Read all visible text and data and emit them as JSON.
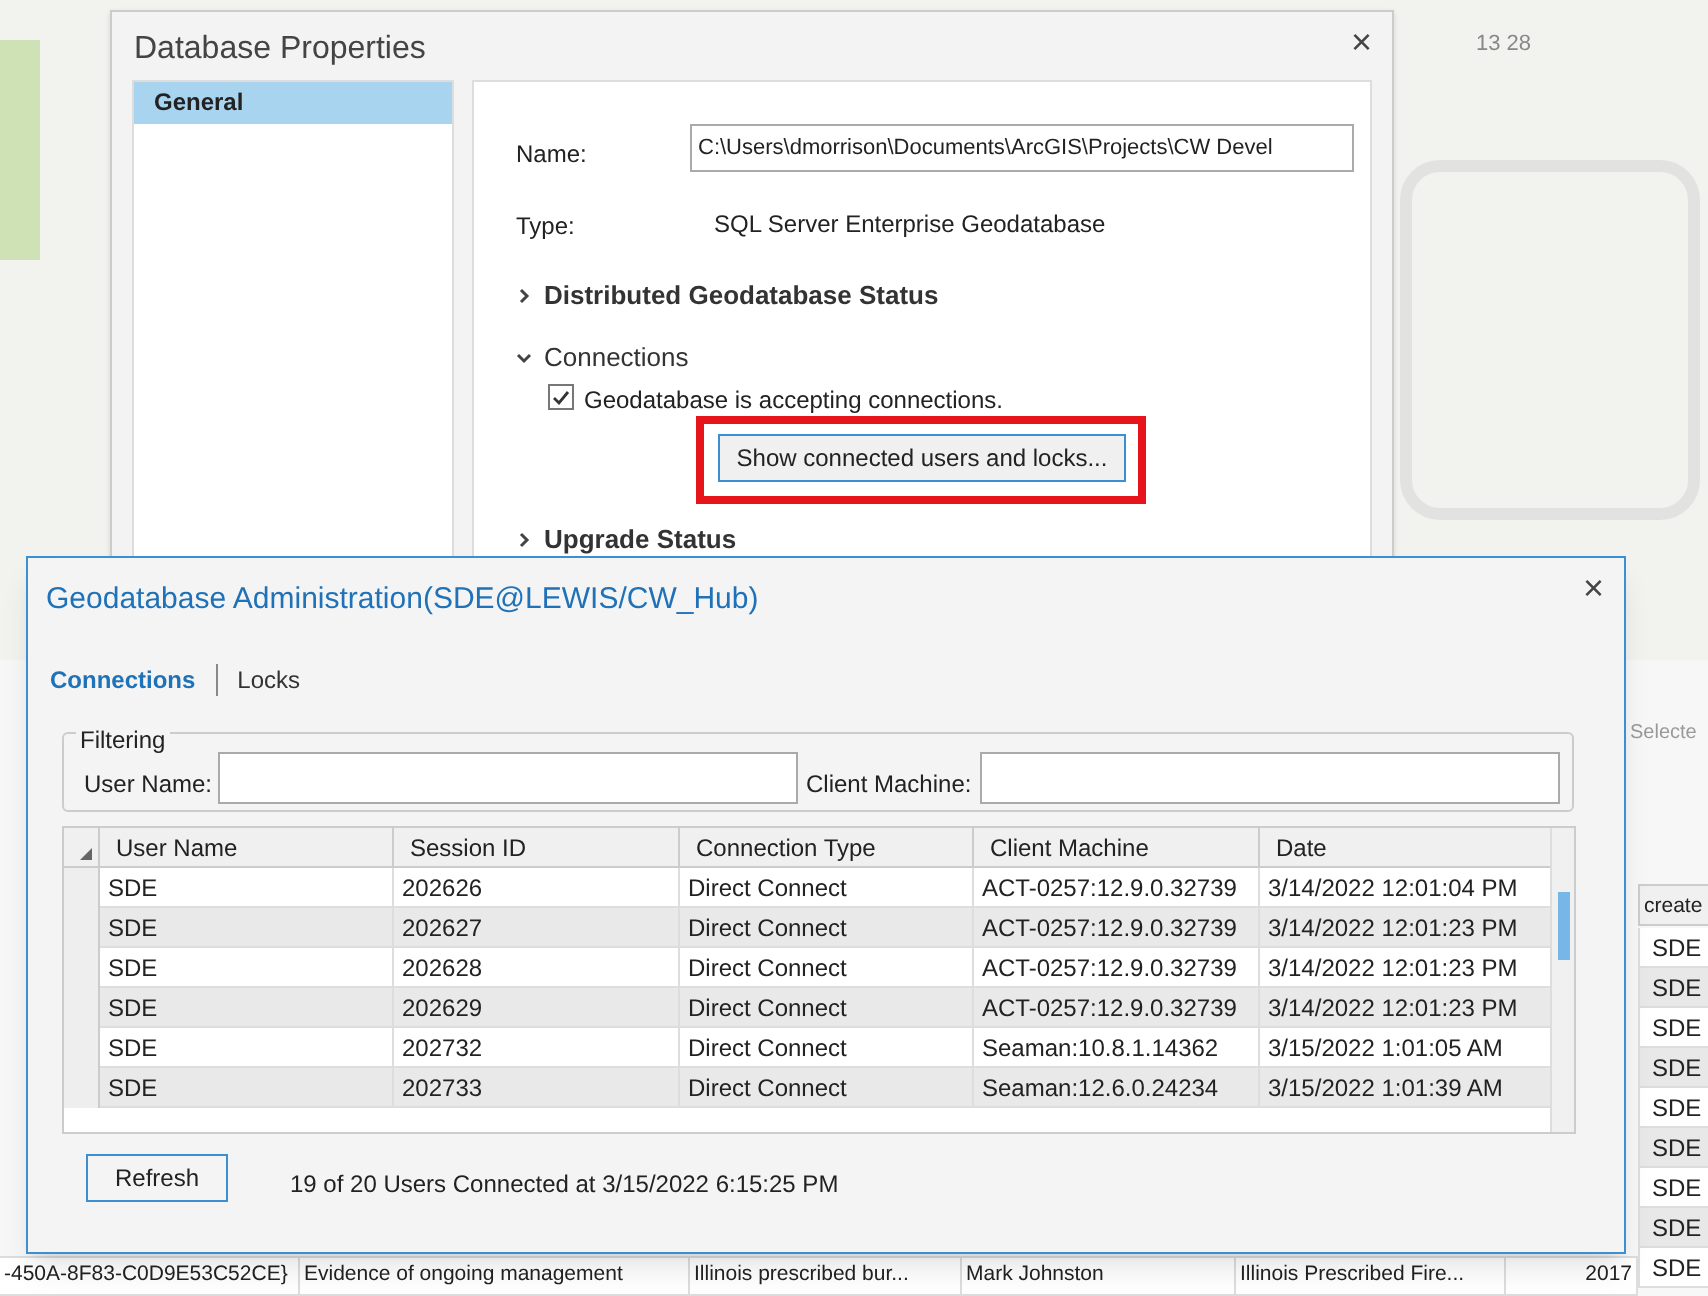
{
  "background": {
    "map_label": "13 28",
    "selection_label": "Selecte",
    "side_column": {
      "header": "create",
      "cells": [
        "SDE",
        "SDE",
        "SDE",
        "SDE",
        "SDE",
        "SDE",
        "SDE",
        "SDE",
        "SDE"
      ]
    },
    "bottom_row": [
      "-450A-8F83-C0D9E53C52CE}",
      "Evidence of ongoing management",
      "Illinois prescribed bur...",
      "Mark Johnston",
      "Illinois Prescribed Fire...",
      "2017"
    ]
  },
  "properties_dialog": {
    "title": "Database Properties",
    "close": "×",
    "nav": [
      {
        "label": "General",
        "selected": true
      }
    ],
    "name_label": "Name:",
    "name_value": "C:\\Users\\dmorrison\\Documents\\ArcGIS\\Projects\\CW Devel",
    "type_label": "Type:",
    "type_value": "SQL Server Enterprise Geodatabase",
    "sections": [
      {
        "title": "Distributed Geodatabase Status",
        "expanded": false
      },
      {
        "title": "Connections",
        "expanded": true
      },
      {
        "title": "Upgrade Status",
        "expanded": false
      }
    ],
    "accepting": {
      "label": "Geodatabase is accepting connections.",
      "checked": true
    },
    "show_button": "Show connected users and locks..."
  },
  "admin_dialog": {
    "title": "Geodatabase Administration(SDE@LEWIS/CW_Hub)",
    "close": "×",
    "tabs": [
      {
        "label": "Connections",
        "selected": true
      },
      {
        "label": "Locks",
        "selected": false
      }
    ],
    "filtering": {
      "title": "Filtering",
      "user_label": "User Name:",
      "machine_label": "Client Machine:"
    },
    "table": {
      "columns": [
        "User Name",
        "Session ID",
        "Connection Type",
        "Client Machine",
        "Date"
      ],
      "rows": [
        [
          "SDE",
          "202626",
          "Direct Connect",
          "ACT-0257:12.9.0.32739",
          "3/14/2022 12:01:04 PM"
        ],
        [
          "SDE",
          "202627",
          "Direct Connect",
          "ACT-0257:12.9.0.32739",
          "3/14/2022 12:01:23 PM"
        ],
        [
          "SDE",
          "202628",
          "Direct Connect",
          "ACT-0257:12.9.0.32739",
          "3/14/2022 12:01:23 PM"
        ],
        [
          "SDE",
          "202629",
          "Direct Connect",
          "ACT-0257:12.9.0.32739",
          "3/14/2022 12:01:23 PM"
        ],
        [
          "SDE",
          "202732",
          "Direct Connect",
          "Seaman:10.8.1.14362",
          "3/15/2022 1:01:05 AM"
        ],
        [
          "SDE",
          "202733",
          "Direct Connect",
          "Seaman:12.6.0.24234",
          "3/15/2022 1:01:39 AM"
        ]
      ]
    },
    "refresh": "Refresh",
    "status": "19 of 20 Users Connected at 3/15/2022 6:15:25 PM"
  }
}
